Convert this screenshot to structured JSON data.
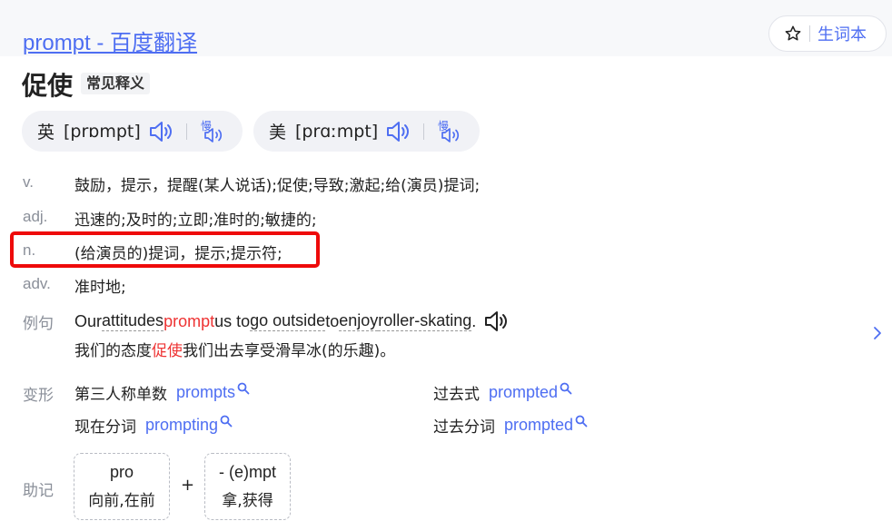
{
  "header": {
    "title": "prompt - 百度翻译",
    "vocab_button": "生词本"
  },
  "entry": {
    "headword": "促使",
    "tag": "常见释义"
  },
  "pronunciations": [
    {
      "lang": "英",
      "ipa": "[prɒmpt]",
      "slow_icon": "慢"
    },
    {
      "lang": "美",
      "ipa": "[prɑːmpt]",
      "slow_icon": "慢"
    }
  ],
  "definitions": [
    {
      "pos": "v.",
      "text": "鼓励，提示，提醒(某人说话);促使;导致;激起;给(演员)提词;"
    },
    {
      "pos": "adj.",
      "text": "迅速的;及时的;立即;准时的;敏捷的;"
    },
    {
      "pos": "n.",
      "text": "(给演员的)提词，提示;提示符;"
    },
    {
      "pos": "adv.",
      "text": "准时地;"
    }
  ],
  "example": {
    "label": "例句",
    "en_parts": [
      "Our ",
      "attitudes",
      " ",
      "prompt",
      " us to ",
      "go outside",
      " to ",
      "enjoy",
      " ",
      "roller-skating",
      "."
    ],
    "cn_before": "我们的态度",
    "cn_keyword": "促使",
    "cn_after": "我们出去享受滑旱冰(的乐趣)。"
  },
  "inflections": {
    "label": "变形",
    "items": [
      {
        "label": "第三人称单数",
        "word": "prompts"
      },
      {
        "label": "过去式",
        "word": "prompted"
      },
      {
        "label": "现在分词",
        "word": "prompting"
      },
      {
        "label": "过去分词",
        "word": "prompted"
      }
    ]
  },
  "mnemonic": {
    "label": "助记",
    "parts": [
      {
        "piece": "pro",
        "meaning": "向前,在前"
      },
      {
        "piece": "- (e)mpt",
        "meaning": "拿,获得"
      }
    ],
    "plus": "+"
  },
  "colors": {
    "link_blue": "#4e6ef2",
    "highlight_red": "#ee0a0a",
    "keyword_red": "#e33",
    "muted_gray": "#8a8f99"
  }
}
